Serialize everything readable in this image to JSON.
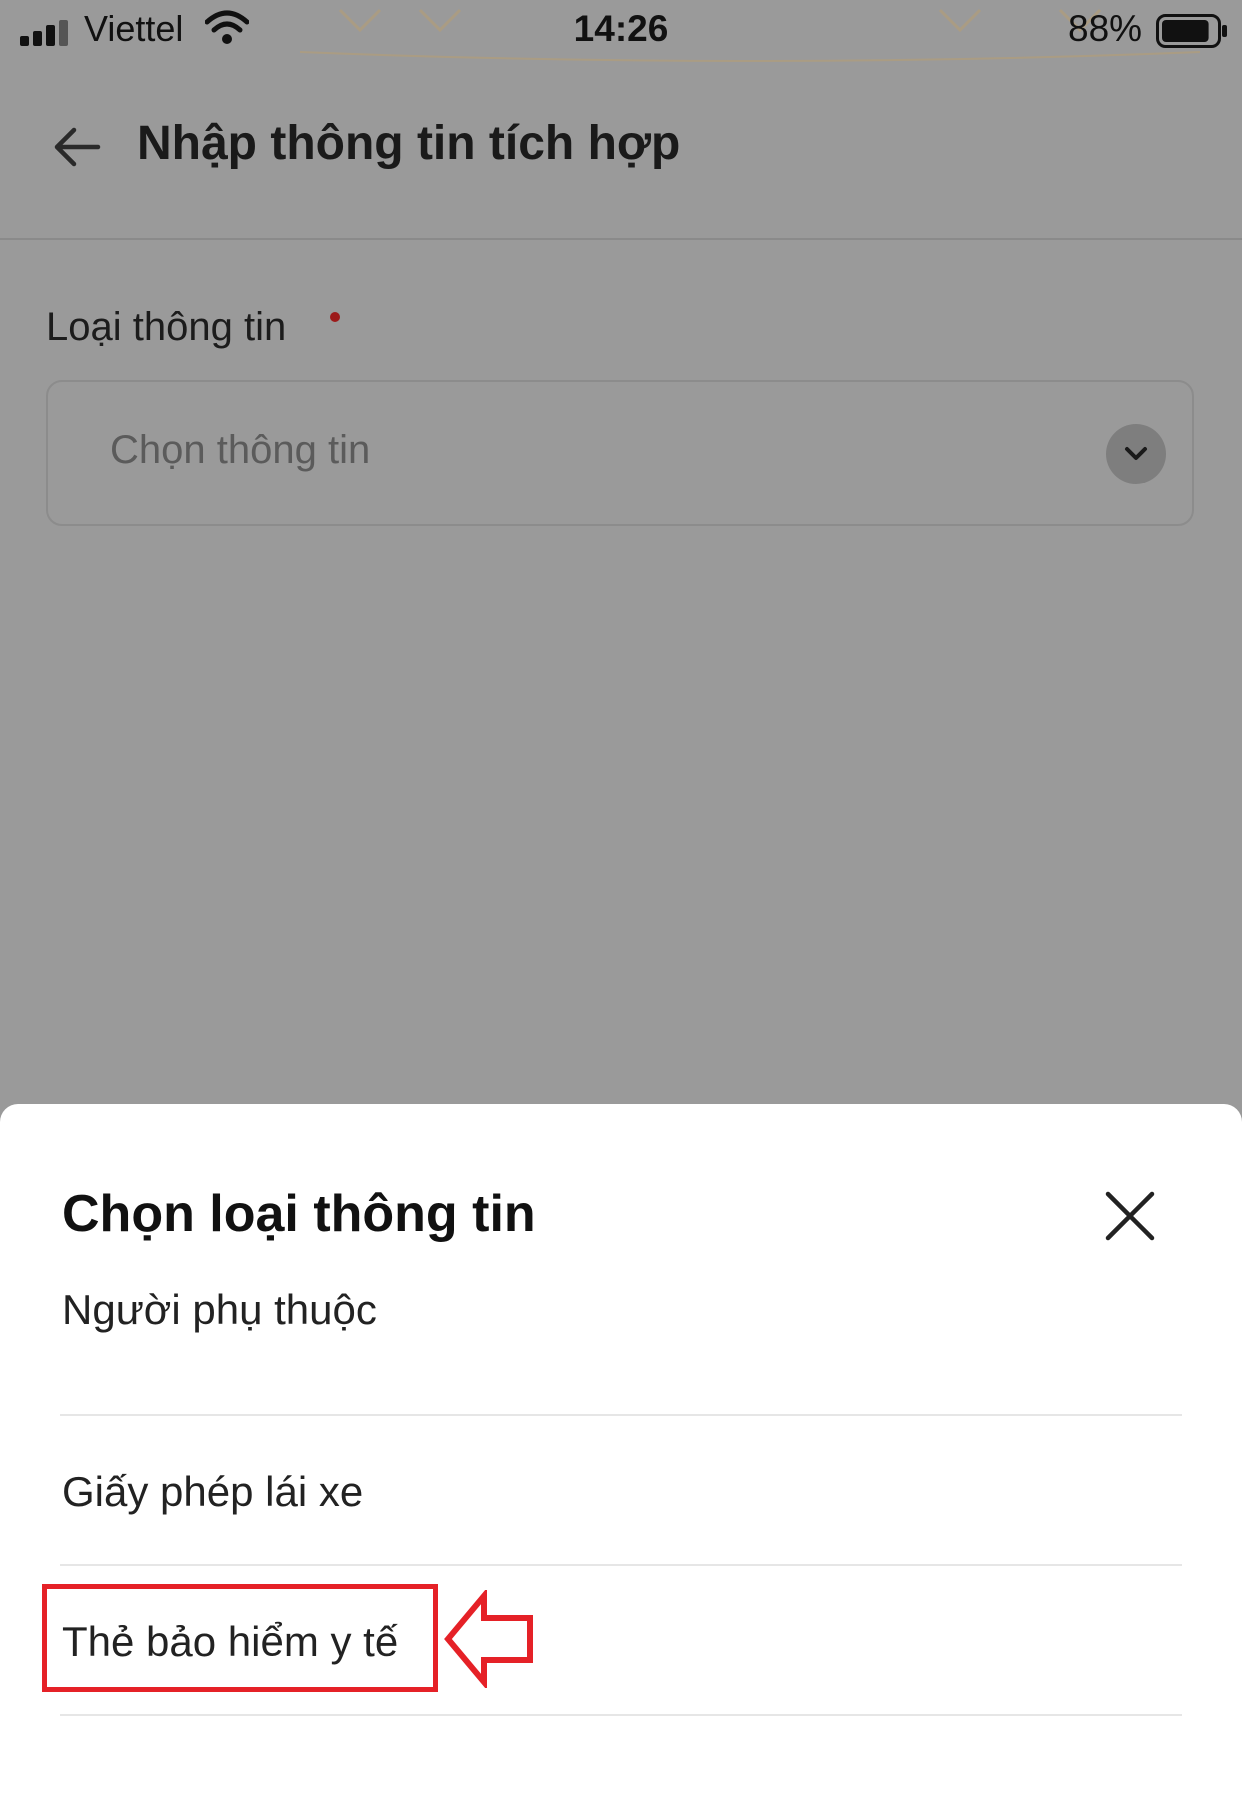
{
  "status_bar": {
    "carrier": "Viettel",
    "time": "14:26",
    "battery_percent": "88%",
    "battery_level": 0.88,
    "icons": [
      "signal-icon",
      "wifi-icon",
      "battery-icon"
    ]
  },
  "header": {
    "title": "Nhập thông tin tích hợp",
    "back_icon": "arrow-left-icon"
  },
  "form": {
    "label": "Loại thông tin",
    "required": true,
    "select_placeholder": "Chọn thông tin",
    "select_icon": "chevron-down-icon"
  },
  "sheet": {
    "title": "Chọn loại thông tin",
    "close_icon": "close-icon",
    "options": [
      {
        "label": "Người phụ thuộc"
      },
      {
        "label": "Giấy phép lái xe"
      },
      {
        "label": "Thẻ bảo hiểm y tế",
        "highlighted": true
      }
    ]
  },
  "annotation": {
    "highlight_color": "#e52127",
    "pointer_icon": "arrow-left-outline-icon"
  },
  "colors": {
    "overlay": "#9a9a9a",
    "required_dot": "#9c1a1a",
    "sheet_background": "#ffffff"
  }
}
